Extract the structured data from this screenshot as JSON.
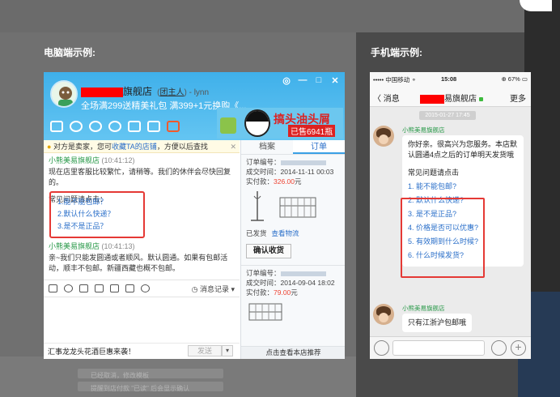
{
  "labels": {
    "pc_section": "电脑端示例:",
    "mobile_section": "手机端示例:"
  },
  "background": {
    "rows": [
      "已经取消，修改模板",
      "提醒到店付款 \"已读\" 后会显示确认"
    ]
  },
  "pc": {
    "shop_suffix": "旗舰店",
    "role": "(",
    "role_name": "团主人",
    "role_rest": ") - lynn",
    "promo": "全场满299送精美礼包  满399+1元换购《...",
    "window_buttons": [
      "◎",
      "—",
      "□",
      "✕"
    ],
    "banner": {
      "label": "搞头油头屑",
      "sub": "已售6941瓶"
    },
    "notice": {
      "prefix": "对方是卖家，您可",
      "link": "收藏TA的店铺",
      "suffix": "，方便以后查找",
      "close": "✕"
    },
    "messages": [
      {
        "sender": "小熊美易旗舰店",
        "time": "(10:41:12)",
        "text": "现在店里客服比较繁忙，请稍等。我们的休伴会尽快回复的。"
      },
      {
        "sender": "小熊美易旗舰店",
        "time": "(10:41:13)",
        "text": "亲~我们只能发圆通或者顺风。默认圆通。如果有包邮活动，顺丰不包邮。新疆西藏也概不包邮。"
      }
    ],
    "faq_title": "常见问题请点击：",
    "faq": [
      "1.能不能包邮？",
      "2.默认什么快递？",
      "3.是不是正品？"
    ],
    "history": "消息记录",
    "footer_text": "汇事龙龙头花酒巨惠来袭！",
    "send": "发送",
    "send_arrow": "▾",
    "tabs": [
      "档案",
      "订单"
    ],
    "orders": [
      {
        "label_no": "订单编号：",
        "label_date": "成交时间：",
        "date": "2014-11-11 00:03",
        "label_paid": "实付款：",
        "price": "326.00",
        "unit": "元"
      },
      {
        "label_no": "订单编号：",
        "label_date": "成交时间：",
        "date": "2014-09-04 18:02",
        "label_paid": "实付款：",
        "price": "79.00",
        "unit": "元"
      }
    ],
    "shipped": "已发货",
    "logistics": "查看物流",
    "confirm": "确认收货",
    "side_footer": "点击查看本店推荐"
  },
  "mobile": {
    "carrier": "••••• 中国移动 ⚬",
    "clock": "15:08",
    "battery": "⊕ 67% ▭",
    "back": "〈 消息",
    "title_suffix": "易旗舰店",
    "more": "更多",
    "date": "2015-01-27 17:45",
    "sender": "小熊美易旗舰店",
    "greeting": "你好亲。很高兴为您服务。本店默认圆通4点之后的订单明天发货哦",
    "faq_title": "常见问题请点击",
    "faq": [
      "1. 能不能包邮?",
      "2. 默认什么快递?",
      "3. 是不是正品?",
      "4. 价格是否可以优惠?",
      "5. 有效期到什么时候?",
      "6. 什么时候发货?"
    ],
    "sender2": "小熊美易旗舰店",
    "reply": "只有江浙沪包邮哦"
  }
}
